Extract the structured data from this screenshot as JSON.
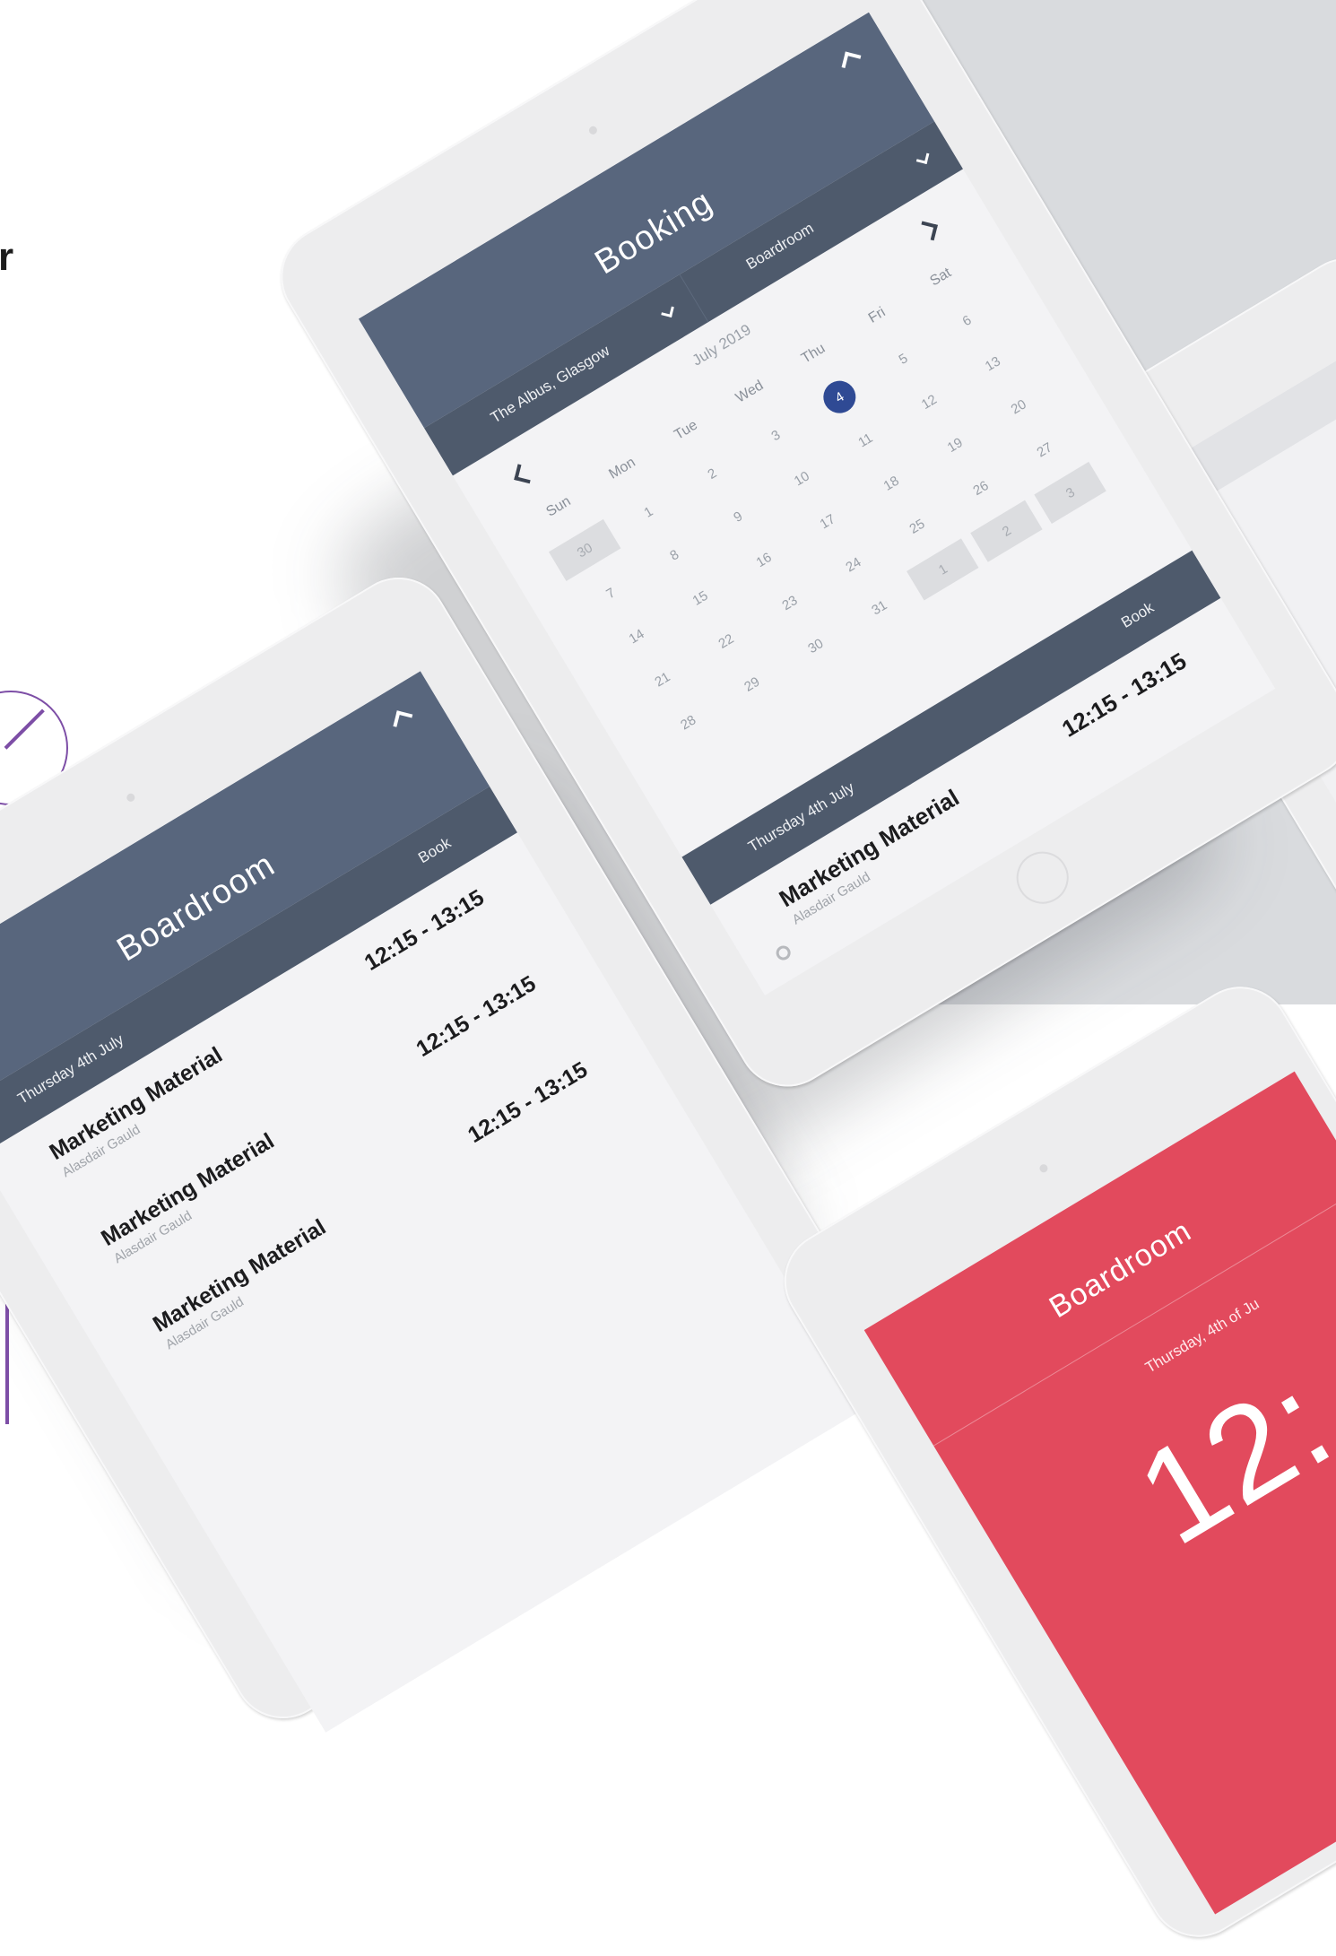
{
  "page": {
    "heading_fragment": "r"
  },
  "booking_tablet": {
    "title": "Booking",
    "location": "The Albus, Glasgow",
    "room": "Boardroom",
    "month": "July 2019",
    "weekdays": [
      "Sun",
      "Mon",
      "Tue",
      "Wed",
      "Thu",
      "Fri",
      "Sat"
    ],
    "weeks": [
      [
        "30",
        "1",
        "2",
        "3",
        "4",
        "5",
        "6"
      ],
      [
        "7",
        "8",
        "9",
        "10",
        "11",
        "12",
        "13"
      ],
      [
        "14",
        "15",
        "16",
        "17",
        "18",
        "19",
        "20"
      ],
      [
        "21",
        "22",
        "23",
        "24",
        "25",
        "26",
        "27"
      ],
      [
        "28",
        "29",
        "30",
        "31",
        "1",
        "2",
        "3"
      ]
    ],
    "selected_day": "4",
    "date_label": "Thursday 4th July",
    "book_label": "Book",
    "booking": {
      "title": "Marketing Material",
      "person": "Alasdair Gauld",
      "time": "12:15 - 13:15"
    }
  },
  "boardroom_tablet": {
    "title": "Boardroom",
    "date_label": "Thursday 4th July",
    "book_label": "Book",
    "bookings": [
      {
        "title": "Marketing Material",
        "person": "Alasdair Gauld",
        "time": "12:15 - 13:15"
      },
      {
        "title": "Marketing Material",
        "person": "Alasdair Gauld",
        "time": "12:15 - 13:15"
      },
      {
        "title": "Marketing Material",
        "person": "Alasdair Gauld",
        "time": "12:15 - 13:15"
      }
    ]
  },
  "red_tablet": {
    "title": "Boardroom",
    "date_label": "Thursday, 4th of Ju",
    "time": "12:"
  },
  "colors": {
    "header": "#58667d",
    "subheader": "#4e5a6c",
    "selected_day": "#2f4a94",
    "occupied_red": "#e24a5d",
    "accent_purple": "#7d4ea6"
  }
}
